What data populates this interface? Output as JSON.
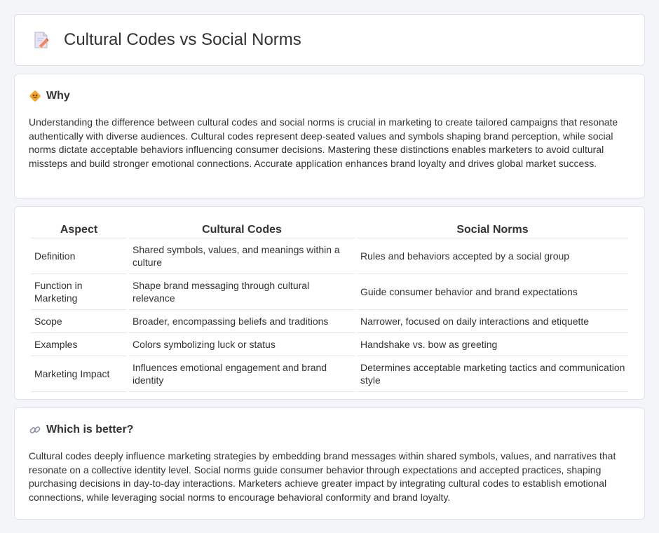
{
  "header": {
    "title": "Cultural Codes vs Social Norms",
    "icon": "document-pencil-icon"
  },
  "why": {
    "title": "Why",
    "icon": "diamond-sign-icon",
    "text": "Understanding the difference between cultural codes and social norms is crucial in marketing to create tailored campaigns that resonate authentically with diverse audiences. Cultural codes represent deep-seated values and symbols shaping brand perception, while social norms dictate acceptable behaviors influencing consumer decisions. Mastering these distinctions enables marketers to avoid cultural missteps and build stronger emotional connections. Accurate application enhances brand loyalty and drives global market success."
  },
  "table": {
    "headers": [
      "Aspect",
      "Cultural Codes",
      "Social Norms"
    ],
    "rows": [
      [
        "Definition",
        "Shared symbols, values, and meanings within a culture",
        "Rules and behaviors accepted by a social group"
      ],
      [
        "Function in Marketing",
        "Shape brand messaging through cultural relevance",
        "Guide consumer behavior and brand expectations"
      ],
      [
        "Scope",
        "Broader, encompassing beliefs and traditions",
        "Narrower, focused on daily interactions and etiquette"
      ],
      [
        "Examples",
        "Colors symbolizing luck or status",
        "Handshake vs. bow as greeting"
      ],
      [
        "Marketing Impact",
        "Influences emotional engagement and brand identity",
        "Determines acceptable marketing tactics and communication style"
      ]
    ]
  },
  "better": {
    "title": "Which is better?",
    "icon": "link-icon",
    "text": "Cultural codes deeply influence marketing strategies by embedding brand messages within shared symbols, values, and narratives that resonate on a collective identity level. Social norms guide consumer behavior through expectations and accepted practices, shaping purchasing decisions in day-to-day interactions. Marketers achieve greater impact by integrating cultural codes to establish emotional connections, while leveraging social norms to encourage behavioral conformity and brand loyalty."
  },
  "colors": {
    "background": "#f3f5f9",
    "card": "#ffffff",
    "border": "#dfe3ea",
    "text": "#333333",
    "accent_orange": "#f5a524"
  }
}
